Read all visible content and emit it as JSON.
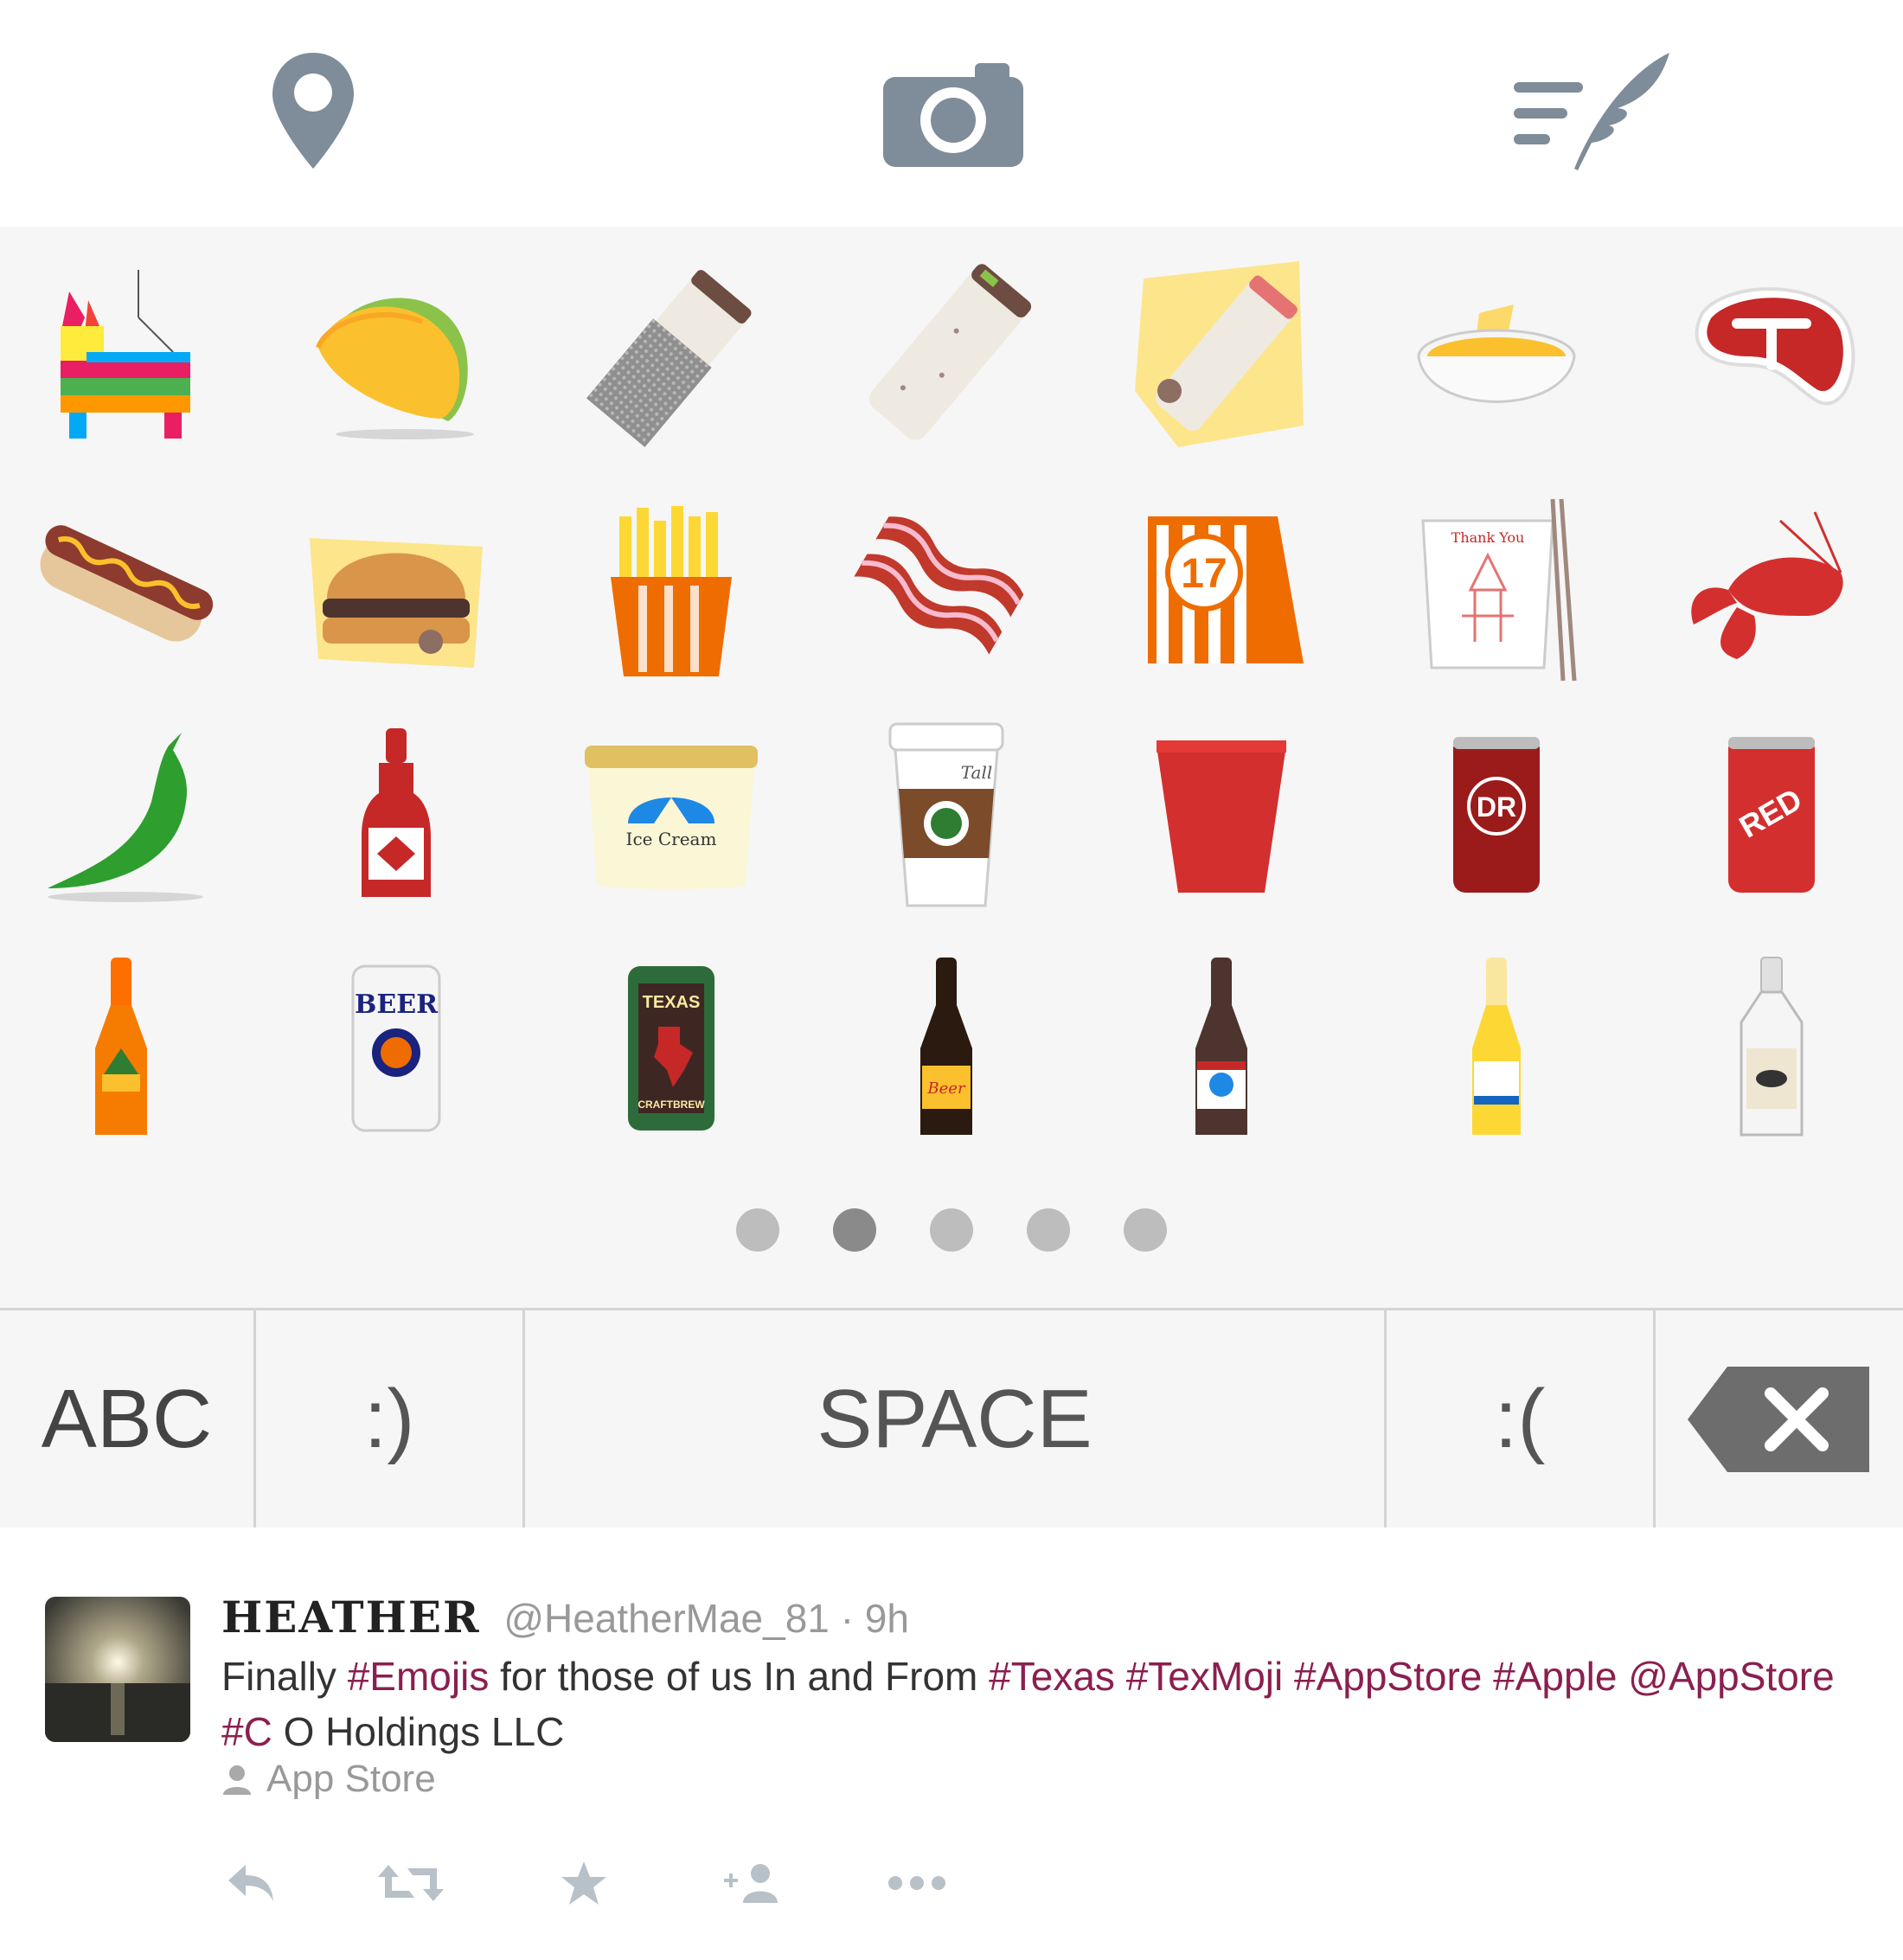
{
  "toolbar": {
    "items": [
      {
        "name": "location",
        "icon": "location-pin-icon"
      },
      {
        "name": "camera",
        "icon": "camera-icon"
      },
      {
        "name": "compose",
        "icon": "quill-compose-icon"
      }
    ],
    "icon_color": "#7f8c99"
  },
  "emoji_panel": {
    "rows": [
      [
        "pinata",
        "taco",
        "burrito-foil",
        "burrito",
        "burrito-paper",
        "queso-bowl",
        "steak"
      ],
      [
        "hot-dog",
        "burger",
        "fries",
        "bacon",
        "order-number-tent",
        "takeout-box",
        "crawfish"
      ],
      [
        "jalapeno",
        "hot-sauce",
        "ice-cream-tub",
        "coffee-cup",
        "red-solo-cup",
        "dr-pepper-can",
        "big-red-can"
      ],
      [
        "orange-soda-bottle",
        "beer-can",
        "texas-beer-can",
        "dark-beer-bottle",
        "amber-beer-bottle",
        "corona-bottle",
        "vodka-bottle"
      ]
    ],
    "labels": {
      "takeout_note": "Thank You",
      "order_number": "17",
      "ice_cream": "Ice Cream",
      "coffee": "Tall",
      "dr_can": "DR",
      "red_can": "RED",
      "beer_can": "BEER",
      "texas_can_top": "TEXAS",
      "texas_can_bottom": "CRAFTBREW",
      "dark_bottle": "Beer"
    },
    "pager": {
      "count": 5,
      "active_index": 1
    }
  },
  "keyboard": {
    "abc_label": "ABC",
    "smile_label": ":)",
    "space_label": "SPACE",
    "frown_label": ":(",
    "delete_icon": "backspace-icon"
  },
  "tweet": {
    "display_name": "HEATHER",
    "handle": "@HeatherMae_81",
    "separator": "·",
    "time": "9h",
    "text_parts": [
      {
        "t": "Finally ",
        "tag": false
      },
      {
        "t": "#Emojis",
        "tag": true
      },
      {
        "t": " for those of us In and From ",
        "tag": false
      },
      {
        "t": "#Texas",
        "tag": true
      },
      {
        "t": " ",
        "tag": false
      },
      {
        "t": "#TexMoji",
        "tag": true
      },
      {
        "t": " ",
        "tag": false
      },
      {
        "t": "#AppStore",
        "tag": true
      },
      {
        "t": " ",
        "tag": false
      },
      {
        "t": "#Apple",
        "tag": true
      },
      {
        "t": " ",
        "tag": false
      },
      {
        "t": "@AppStore",
        "tag": true
      },
      {
        "t": " ",
        "tag": false
      },
      {
        "t": "#C",
        "tag": true
      },
      {
        "t": " O Holdings LLC",
        "tag": false
      }
    ],
    "source_label": "App Store",
    "link_color": "#8b1f4f",
    "actions": [
      "reply-icon",
      "retweet-icon",
      "favorite-icon",
      "follow-icon",
      "more-icon"
    ]
  }
}
